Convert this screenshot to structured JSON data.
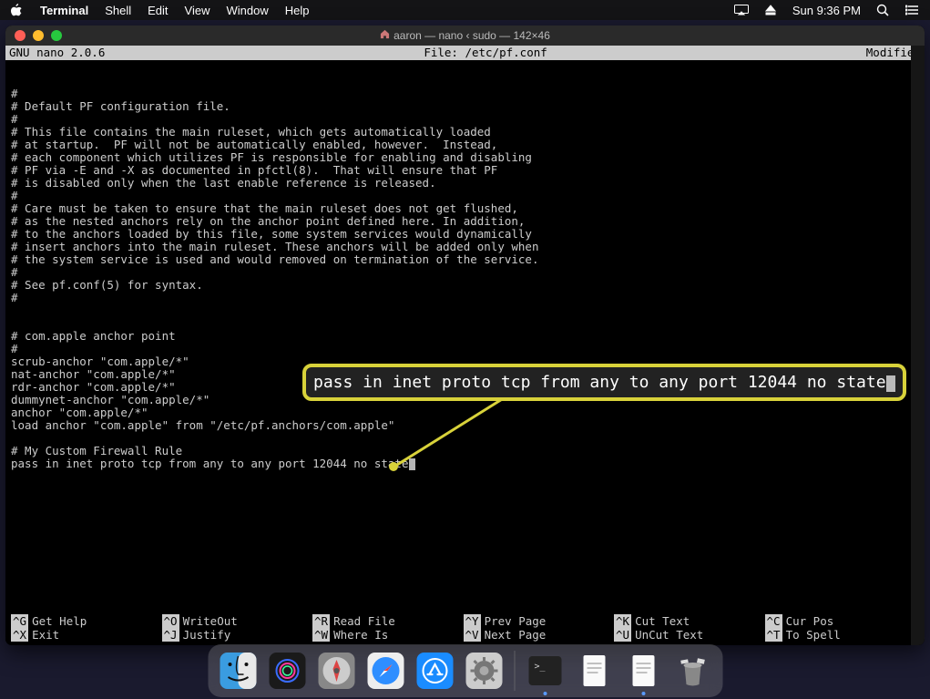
{
  "menubar": {
    "app": "Terminal",
    "items": [
      "Shell",
      "Edit",
      "View",
      "Window",
      "Help"
    ],
    "clock": "Sun 9:36 PM"
  },
  "window": {
    "title_prefix": "aaron — nano ‹ sudo — 142×46"
  },
  "nano": {
    "version_label": "GNU nano 2.0.6",
    "file_label": "File: /etc/pf.conf",
    "modified_label": "Modified",
    "lines": [
      "#",
      "# Default PF configuration file.",
      "#",
      "# This file contains the main ruleset, which gets automatically loaded",
      "# at startup.  PF will not be automatically enabled, however.  Instead,",
      "# each component which utilizes PF is responsible for enabling and disabling",
      "# PF via -E and -X as documented in pfctl(8).  That will ensure that PF",
      "# is disabled only when the last enable reference is released.",
      "#",
      "# Care must be taken to ensure that the main ruleset does not get flushed,",
      "# as the nested anchors rely on the anchor point defined here. In addition,",
      "# to the anchors loaded by this file, some system services would dynamically",
      "# insert anchors into the main ruleset. These anchors will be added only when",
      "# the system service is used and would removed on termination of the service.",
      "#",
      "# See pf.conf(5) for syntax.",
      "#",
      "",
      "",
      "# com.apple anchor point",
      "#",
      "scrub-anchor \"com.apple/*\"",
      "nat-anchor \"com.apple/*\"",
      "rdr-anchor \"com.apple/*\"",
      "dummynet-anchor \"com.apple/*\"",
      "anchor \"com.apple/*\"",
      "load anchor \"com.apple\" from \"/etc/pf.anchors/com.apple\"",
      "",
      "# My Custom Firewall Rule",
      "pass in inet proto tcp from any to any port 12044 no state"
    ],
    "footer": {
      "row1": [
        {
          "key": "^G",
          "label": "Get Help"
        },
        {
          "key": "^O",
          "label": "WriteOut"
        },
        {
          "key": "^R",
          "label": "Read File"
        },
        {
          "key": "^Y",
          "label": "Prev Page"
        },
        {
          "key": "^K",
          "label": "Cut Text"
        },
        {
          "key": "^C",
          "label": "Cur Pos"
        }
      ],
      "row2": [
        {
          "key": "^X",
          "label": "Exit"
        },
        {
          "key": "^J",
          "label": "Justify"
        },
        {
          "key": "^W",
          "label": "Where Is"
        },
        {
          "key": "^V",
          "label": "Next Page"
        },
        {
          "key": "^U",
          "label": "UnCut Text"
        },
        {
          "key": "^T",
          "label": "To Spell"
        }
      ]
    }
  },
  "callout": {
    "text": "pass in inet proto tcp from any to any port 12044 no state"
  },
  "dock": {
    "items": [
      {
        "name": "finder"
      },
      {
        "name": "siri"
      },
      {
        "name": "launchpad"
      },
      {
        "name": "safari"
      },
      {
        "name": "app-store"
      },
      {
        "name": "system-preferences"
      }
    ],
    "right_items": [
      {
        "name": "terminal-doc"
      },
      {
        "name": "textedit-doc"
      },
      {
        "name": "textedit-doc-2"
      },
      {
        "name": "trash"
      }
    ]
  }
}
